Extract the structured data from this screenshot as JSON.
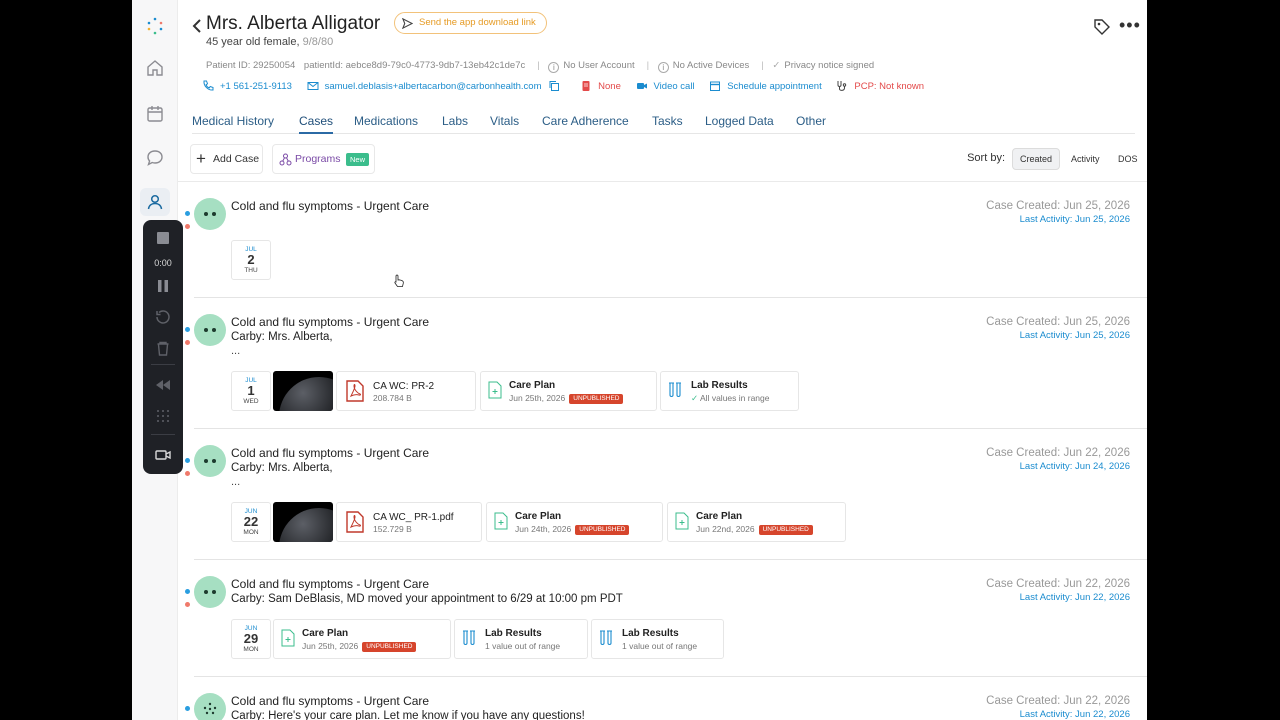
{
  "patient": {
    "name": "Mrs. Alberta Alligator",
    "download_link_label": "Send the app download link",
    "age_sex": "45 year old female,",
    "dob": "9/8/80",
    "patient_id_label": "Patient ID: 29250054",
    "patient_uuid_label": "patientId: aebce8d9-79c0-4773-9db7-13eb42c1de7c",
    "no_user_account": "No User Account",
    "no_active_devices": "No Active Devices",
    "privacy_notice": "Privacy notice signed"
  },
  "contacts": {
    "phone": "+1 561-251-9113",
    "email": "samuel.deblasis+albertacarbon@carbonhealth.com",
    "alert": "None",
    "video_call": "Video call",
    "schedule": "Schedule appointment",
    "pcp": "PCP: Not known"
  },
  "tabs": [
    "Medical History",
    "Cases",
    "Medications",
    "Labs",
    "Vitals",
    "Care Adherence",
    "Tasks",
    "Logged Data",
    "Other"
  ],
  "active_tab": "Cases",
  "toolbar": {
    "add_case": "Add Case",
    "programs": "Programs",
    "programs_badge": "New",
    "sort_by": "Sort by:",
    "sort_options": [
      "Created",
      "Activity",
      "DOS"
    ],
    "sort_selected": "Created"
  },
  "recorder": {
    "time": "0:00"
  },
  "cases": [
    {
      "title": "Cold and flu symptoms - Urgent Care",
      "created": "Case Created: Jun 25, 2026",
      "last_activity": "Last Activity: Jun 25, 2026",
      "date": {
        "mon": "JUL",
        "day": "2",
        "dow": "THU"
      }
    },
    {
      "title": "Cold and flu symptoms - Urgent Care",
      "message": "Carby: Mrs. Alberta,",
      "ellipsis": "...",
      "created": "Case Created: Jun 25, 2026",
      "last_activity": "Last Activity: Jun 25, 2026",
      "date": {
        "mon": "JUL",
        "day": "1",
        "dow": "WED"
      },
      "file": {
        "name": "CA WC: PR-2",
        "size": "208.784 B"
      },
      "care_plan": {
        "title": "Care Plan",
        "date": "Jun 25th, 2026",
        "badge": "UNPUBLISHED"
      },
      "lab": {
        "title": "Lab Results",
        "status": "All values in range"
      }
    },
    {
      "title": "Cold and flu symptoms - Urgent Care",
      "message": "Carby: Mrs. Alberta,",
      "ellipsis": "...",
      "created": "Case Created: Jun 22, 2026",
      "last_activity": "Last Activity: Jun 24, 2026",
      "date": {
        "mon": "JUN",
        "day": "22",
        "dow": "MON"
      },
      "file": {
        "name": "CA WC_ PR-1.pdf",
        "size": "152.729 B"
      },
      "care_plan_a": {
        "title": "Care Plan",
        "date": "Jun 24th, 2026",
        "badge": "UNPUBLISHED"
      },
      "care_plan_b": {
        "title": "Care Plan",
        "date": "Jun 22nd, 2026",
        "badge": "UNPUBLISHED"
      }
    },
    {
      "title": "Cold and flu symptoms - Urgent Care",
      "message": "Carby: Sam DeBlasis, MD moved your appointment to 6/29 at 10:00 pm PDT",
      "created": "Case Created: Jun 22, 2026",
      "last_activity": "Last Activity: Jun 22, 2026",
      "date": {
        "mon": "JUN",
        "day": "29",
        "dow": "MON"
      },
      "care_plan": {
        "title": "Care Plan",
        "date": "Jun 25th, 2026",
        "badge": "UNPUBLISHED"
      },
      "lab_a": {
        "title": "Lab Results",
        "status": "1 value out of range"
      },
      "lab_b": {
        "title": "Lab Results",
        "status": "1 value out of range"
      }
    },
    {
      "title": "Cold and flu symptoms - Urgent Care",
      "message": "Carby: Here's your care plan. Let me know if you have any questions!",
      "created": "Case Created: Jun 22, 2026",
      "last_activity": "Last Activity: Jun 22, 2026"
    }
  ],
  "colors": {
    "link": "#1b8ccf",
    "accent": "#2b6aa5",
    "badge_red": "#d6452c",
    "badge_green": "#3bbd8c",
    "avatar": "#a6dfc2"
  }
}
